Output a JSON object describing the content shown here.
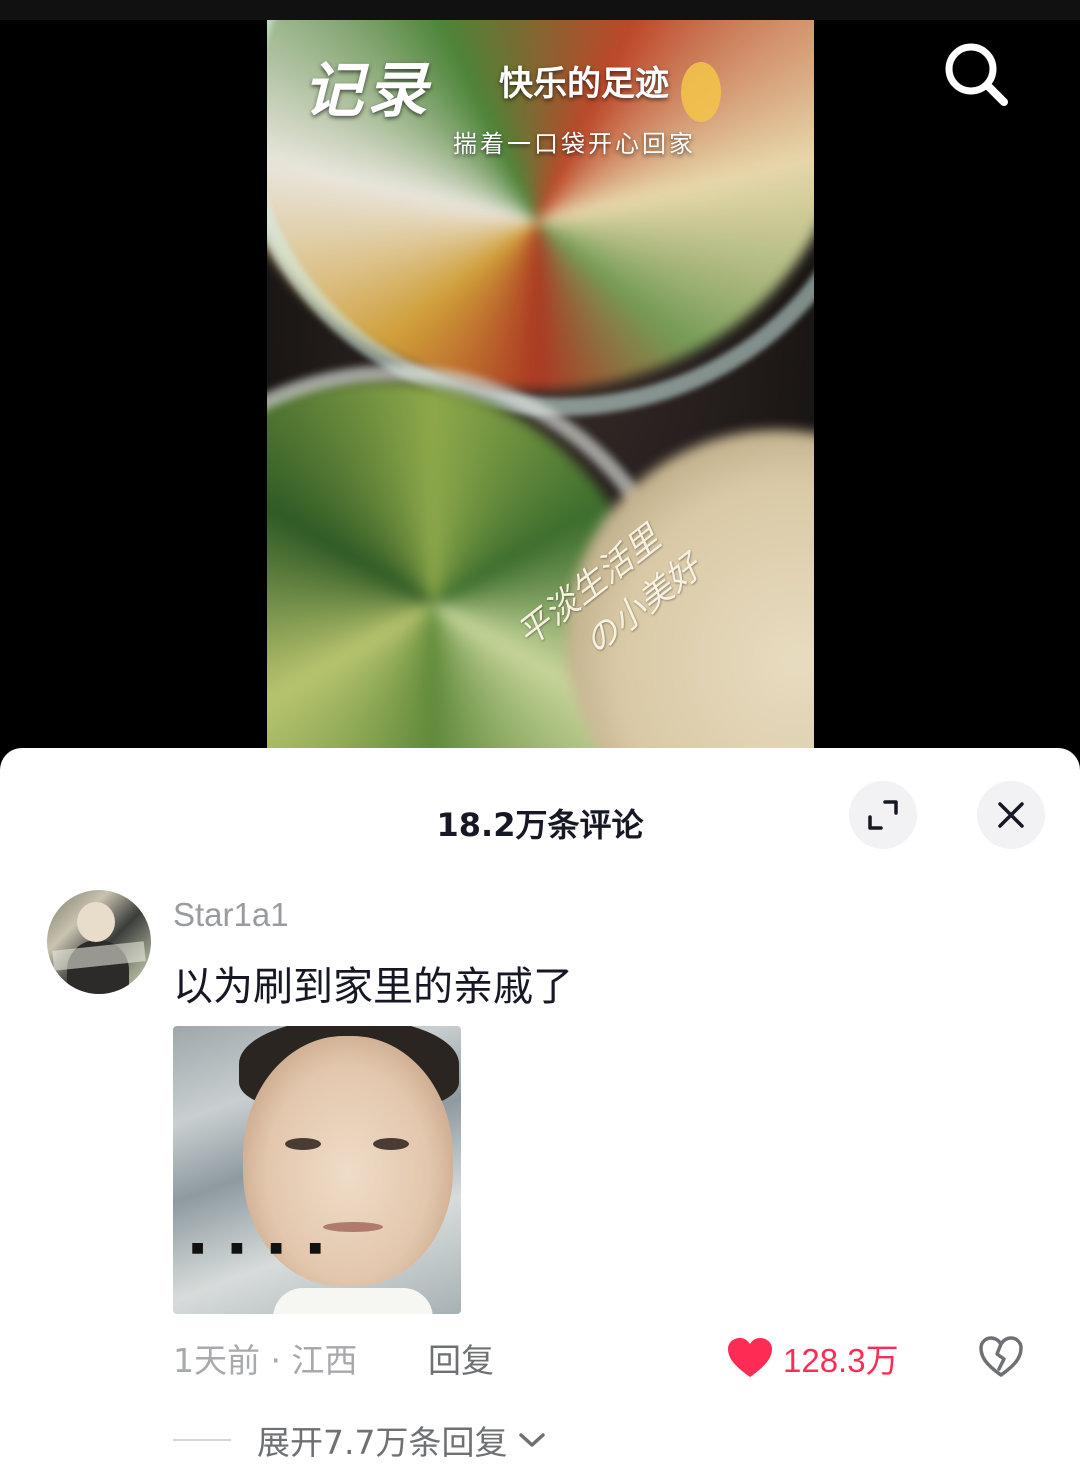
{
  "video": {
    "overlay_title_big": "记录",
    "overlay_title_main": "快乐的足迹",
    "overlay_subtitle": "揣着一口袋开心回家",
    "overlay_handwriting_line1": "平淡生活里",
    "overlay_handwriting_line2": "の小美好"
  },
  "comments_panel": {
    "title": "18.2万条评论",
    "comment": {
      "username": "Star1a1",
      "text": "以为刷到家里的亲戚了",
      "time_location": "1天前 · 江西",
      "reply_label": "回复",
      "like_count": "128.3万",
      "expand_replies_label": "展开7.7万条回复"
    }
  },
  "icons": {
    "search": "search-icon",
    "expand": "expand-icon",
    "close": "close-icon",
    "like": "heart-icon",
    "dislike": "broken-heart-icon",
    "chevron": "chevron-down-icon"
  },
  "colors": {
    "accent_like": "#fe2c55",
    "title_text": "#161823",
    "secondary_text": "#a8a9ad"
  }
}
